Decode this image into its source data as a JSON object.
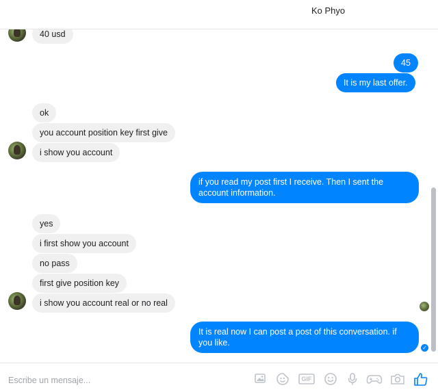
{
  "header": {
    "contact_name": "Ko Phyo"
  },
  "messages": [
    {
      "side": "in",
      "text": "40 usd"
    },
    {
      "side": "out",
      "text": "45"
    },
    {
      "side": "out",
      "text": "It is my last offer."
    },
    {
      "side": "in",
      "text": "ok"
    },
    {
      "side": "in",
      "text": "you account position key first give"
    },
    {
      "side": "in",
      "text": "i show you account"
    },
    {
      "side": "out",
      "text": "if you read my post first I receive. Then I sent the account information."
    },
    {
      "side": "in",
      "text": "yes"
    },
    {
      "side": "in",
      "text": "i first show you account"
    },
    {
      "side": "in",
      "text": "no pass"
    },
    {
      "side": "in",
      "text": "first give position key"
    },
    {
      "side": "in",
      "text": "i show you account  real or no real"
    },
    {
      "side": "out",
      "text": "It is real now I can post a post of this conversation. if you like."
    }
  ],
  "composer": {
    "placeholder": "Escribe un mensaje...",
    "tools": [
      "photo-icon",
      "sticker-icon",
      "gif-icon",
      "emoji-icon",
      "microphone-icon",
      "game-controller-icon",
      "camera-icon",
      "thumbs-up-icon"
    ],
    "gif_label": "GIF"
  },
  "colors": {
    "accent": "#0084ff",
    "incoming_bubble": "#f1f0f0"
  }
}
